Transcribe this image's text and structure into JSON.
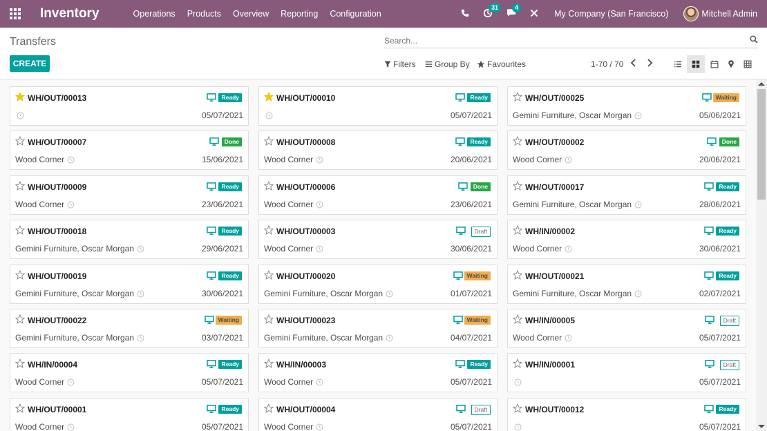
{
  "navbar": {
    "brand": "Inventory",
    "menu": [
      "Operations",
      "Products",
      "Overview",
      "Reporting",
      "Configuration"
    ],
    "activity_count": "31",
    "message_count": "4",
    "company": "My Company (San Francisco)",
    "user": "Mitchell Admin"
  },
  "control": {
    "title": "Transfers",
    "create_label": "CREATE",
    "search_placeholder": "Search...",
    "filters_label": "Filters",
    "groupby_label": "Group By",
    "favourites_label": "Favourites",
    "pager": "1-70 / 70"
  },
  "colors": {
    "brand": "#875a7b",
    "accent": "#00a09d",
    "done": "#28a745",
    "waiting": "#f0ad4e"
  },
  "cards": [
    {
      "ref": "WH/OUT/00013",
      "status": "Ready",
      "partner": "",
      "date": "05/07/2021",
      "starred": true
    },
    {
      "ref": "WH/OUT/00010",
      "status": "Ready",
      "partner": "",
      "date": "05/07/2021",
      "starred": true
    },
    {
      "ref": "WH/OUT/00025",
      "status": "Waiting",
      "partner": "Gemini Furniture, Oscar Morgan",
      "date": "05/06/2021",
      "starred": false
    },
    {
      "ref": "WH/OUT/00007",
      "status": "Done",
      "partner": "Wood Corner",
      "date": "15/06/2021",
      "starred": false
    },
    {
      "ref": "WH/OUT/00008",
      "status": "Ready",
      "partner": "Wood Corner",
      "date": "20/06/2021",
      "starred": false
    },
    {
      "ref": "WH/OUT/00002",
      "status": "Done",
      "partner": "Wood Corner",
      "date": "20/06/2021",
      "starred": false
    },
    {
      "ref": "WH/OUT/00009",
      "status": "Ready",
      "partner": "Wood Corner",
      "date": "23/06/2021",
      "starred": false
    },
    {
      "ref": "WH/OUT/00006",
      "status": "Done",
      "partner": "Wood Corner",
      "date": "23/06/2021",
      "starred": false
    },
    {
      "ref": "WH/OUT/00017",
      "status": "Ready",
      "partner": "Gemini Furniture, Oscar Morgan",
      "date": "28/06/2021",
      "starred": false
    },
    {
      "ref": "WH/OUT/00018",
      "status": "Ready",
      "partner": "Gemini Furniture, Oscar Morgan",
      "date": "29/06/2021",
      "starred": false
    },
    {
      "ref": "WH/OUT/00003",
      "status": "Draft",
      "partner": "Wood Corner",
      "date": "30/06/2021",
      "starred": false
    },
    {
      "ref": "WH/IN/00002",
      "status": "Ready",
      "partner": "Wood Corner",
      "date": "30/06/2021",
      "starred": false
    },
    {
      "ref": "WH/OUT/00019",
      "status": "Ready",
      "partner": "Gemini Furniture, Oscar Morgan",
      "date": "30/06/2021",
      "starred": false
    },
    {
      "ref": "WH/OUT/00020",
      "status": "Waiting",
      "partner": "Gemini Furniture, Oscar Morgan",
      "date": "01/07/2021",
      "starred": false
    },
    {
      "ref": "WH/OUT/00021",
      "status": "Ready",
      "partner": "Gemini Furniture, Oscar Morgan",
      "date": "02/07/2021",
      "starred": false
    },
    {
      "ref": "WH/OUT/00022",
      "status": "Waiting",
      "partner": "Gemini Furniture, Oscar Morgan",
      "date": "03/07/2021",
      "starred": false
    },
    {
      "ref": "WH/OUT/00023",
      "status": "Waiting",
      "partner": "Gemini Furniture, Oscar Morgan",
      "date": "04/07/2021",
      "starred": false
    },
    {
      "ref": "WH/IN/00005",
      "status": "Draft",
      "partner": "Wood Corner",
      "date": "05/07/2021",
      "starred": false
    },
    {
      "ref": "WH/IN/00004",
      "status": "Ready",
      "partner": "Wood Corner",
      "date": "05/07/2021",
      "starred": false
    },
    {
      "ref": "WH/IN/00003",
      "status": "Ready",
      "partner": "Wood Corner",
      "date": "05/07/2021",
      "starred": false
    },
    {
      "ref": "WH/IN/00001",
      "status": "Draft",
      "partner": "",
      "date": "05/07/2021",
      "starred": false
    },
    {
      "ref": "WH/OUT/00001",
      "status": "Ready",
      "partner": "Wood Corner",
      "date": "05/07/2021",
      "starred": false
    },
    {
      "ref": "WH/OUT/00004",
      "status": "Draft",
      "partner": "Wood Corner",
      "date": "05/07/2021",
      "starred": false
    },
    {
      "ref": "WH/OUT/00012",
      "status": "Ready",
      "partner": "",
      "date": "05/07/2021",
      "starred": false
    }
  ]
}
